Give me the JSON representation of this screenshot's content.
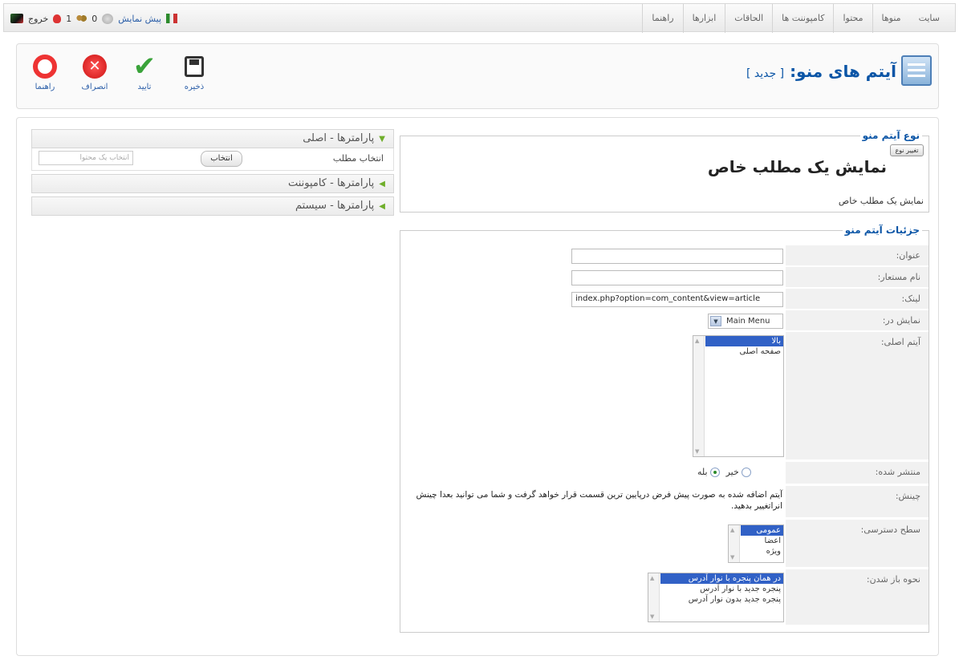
{
  "topbar": {
    "menu": [
      "سایت",
      "منوها",
      "محتوا",
      "کامپوننت ها",
      "الحاقات",
      "ابزارها",
      "راهنما"
    ],
    "status": {
      "logout_label": "خروج",
      "messages_count": "1",
      "users_count": "0",
      "preview_label": "پیش نمایش"
    }
  },
  "header": {
    "title": "آیتم های منو:",
    "subtitle": "[ جدید ]",
    "toolbar": {
      "help": "راهنما",
      "cancel": "انصراف",
      "apply": "تایید",
      "save": "ذخیره"
    }
  },
  "params": {
    "basic": "پارامترها - اصلی",
    "select_article_label": "انتخاب مطلب",
    "select_button": "انتخاب",
    "article_placeholder": "انتخاب یک محتوا",
    "component": "پارامترها - کامپوننت",
    "system": "پارامترها - سیستم"
  },
  "menu_type": {
    "legend": "نوع آیتم منو",
    "change_button": "تغییر نوع",
    "title": "نمایش یک مطلب خاص",
    "description": "نمایش یک مطلب خاص"
  },
  "details": {
    "legend": "جزئیات آیتم منو",
    "title_label": "عنوان:",
    "title_value": "",
    "alias_label": "نام مستعار:",
    "alias_value": "",
    "link_label": "لینک:",
    "link_value": "index.php?option=com_content&view=article",
    "display_in_label": "نمایش در:",
    "display_in_value": "Main Menu",
    "parent_label": "آیتم اصلی:",
    "parent_options": [
      "بالا",
      "صفحه اصلی"
    ],
    "published_label": "منتشر شده:",
    "published_no": "خیر",
    "published_yes": "بله",
    "order_label": "چینش:",
    "order_text": "آیتم اضافه شده به صورت پیش فرض درپایین ترین قسمت قرار خواهد گرفت و شما می توانید بعدا چینش انراتغییر بدهید.",
    "access_label": "سطح دسترسی:",
    "access_options": [
      "عمومی",
      "اعضا",
      "ویژه"
    ],
    "target_label": "نحوه باز شدن:",
    "target_options": [
      "در همان پنجره با نوار آدرس",
      "پنجره جدید با نوار آدرس",
      "پنجره جدید بدون نوار آدرس"
    ]
  }
}
